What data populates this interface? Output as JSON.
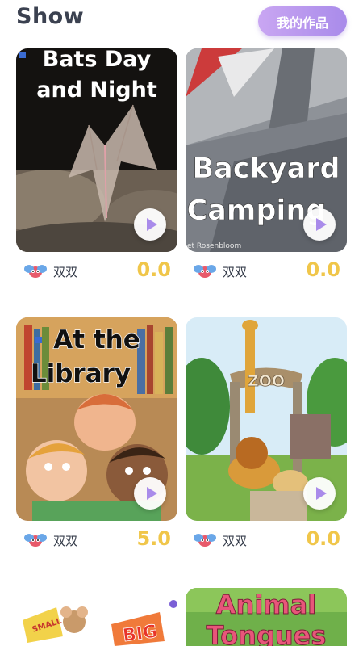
{
  "header": {
    "title": "Show",
    "my_works_label": "我的作品"
  },
  "books": [
    {
      "title_line1": "Bats Day",
      "title_line2": "and Night",
      "author": "双双",
      "score": "0.0"
    },
    {
      "title_line1": "Backyard",
      "title_line2": "Camping",
      "author_credit": "et Rosenbloom",
      "author": "双双",
      "score": "0.0"
    },
    {
      "title_line1": "At the",
      "title_line2": "Library",
      "author": "双双",
      "score": "5.0"
    },
    {
      "sign": "ZOO",
      "author": "双双",
      "score": "0.0"
    },
    {
      "sign_small": "SMALL",
      "sign_big": "BIG"
    },
    {
      "title_line1": "Animal",
      "title_line2": "Tongues"
    }
  ]
}
